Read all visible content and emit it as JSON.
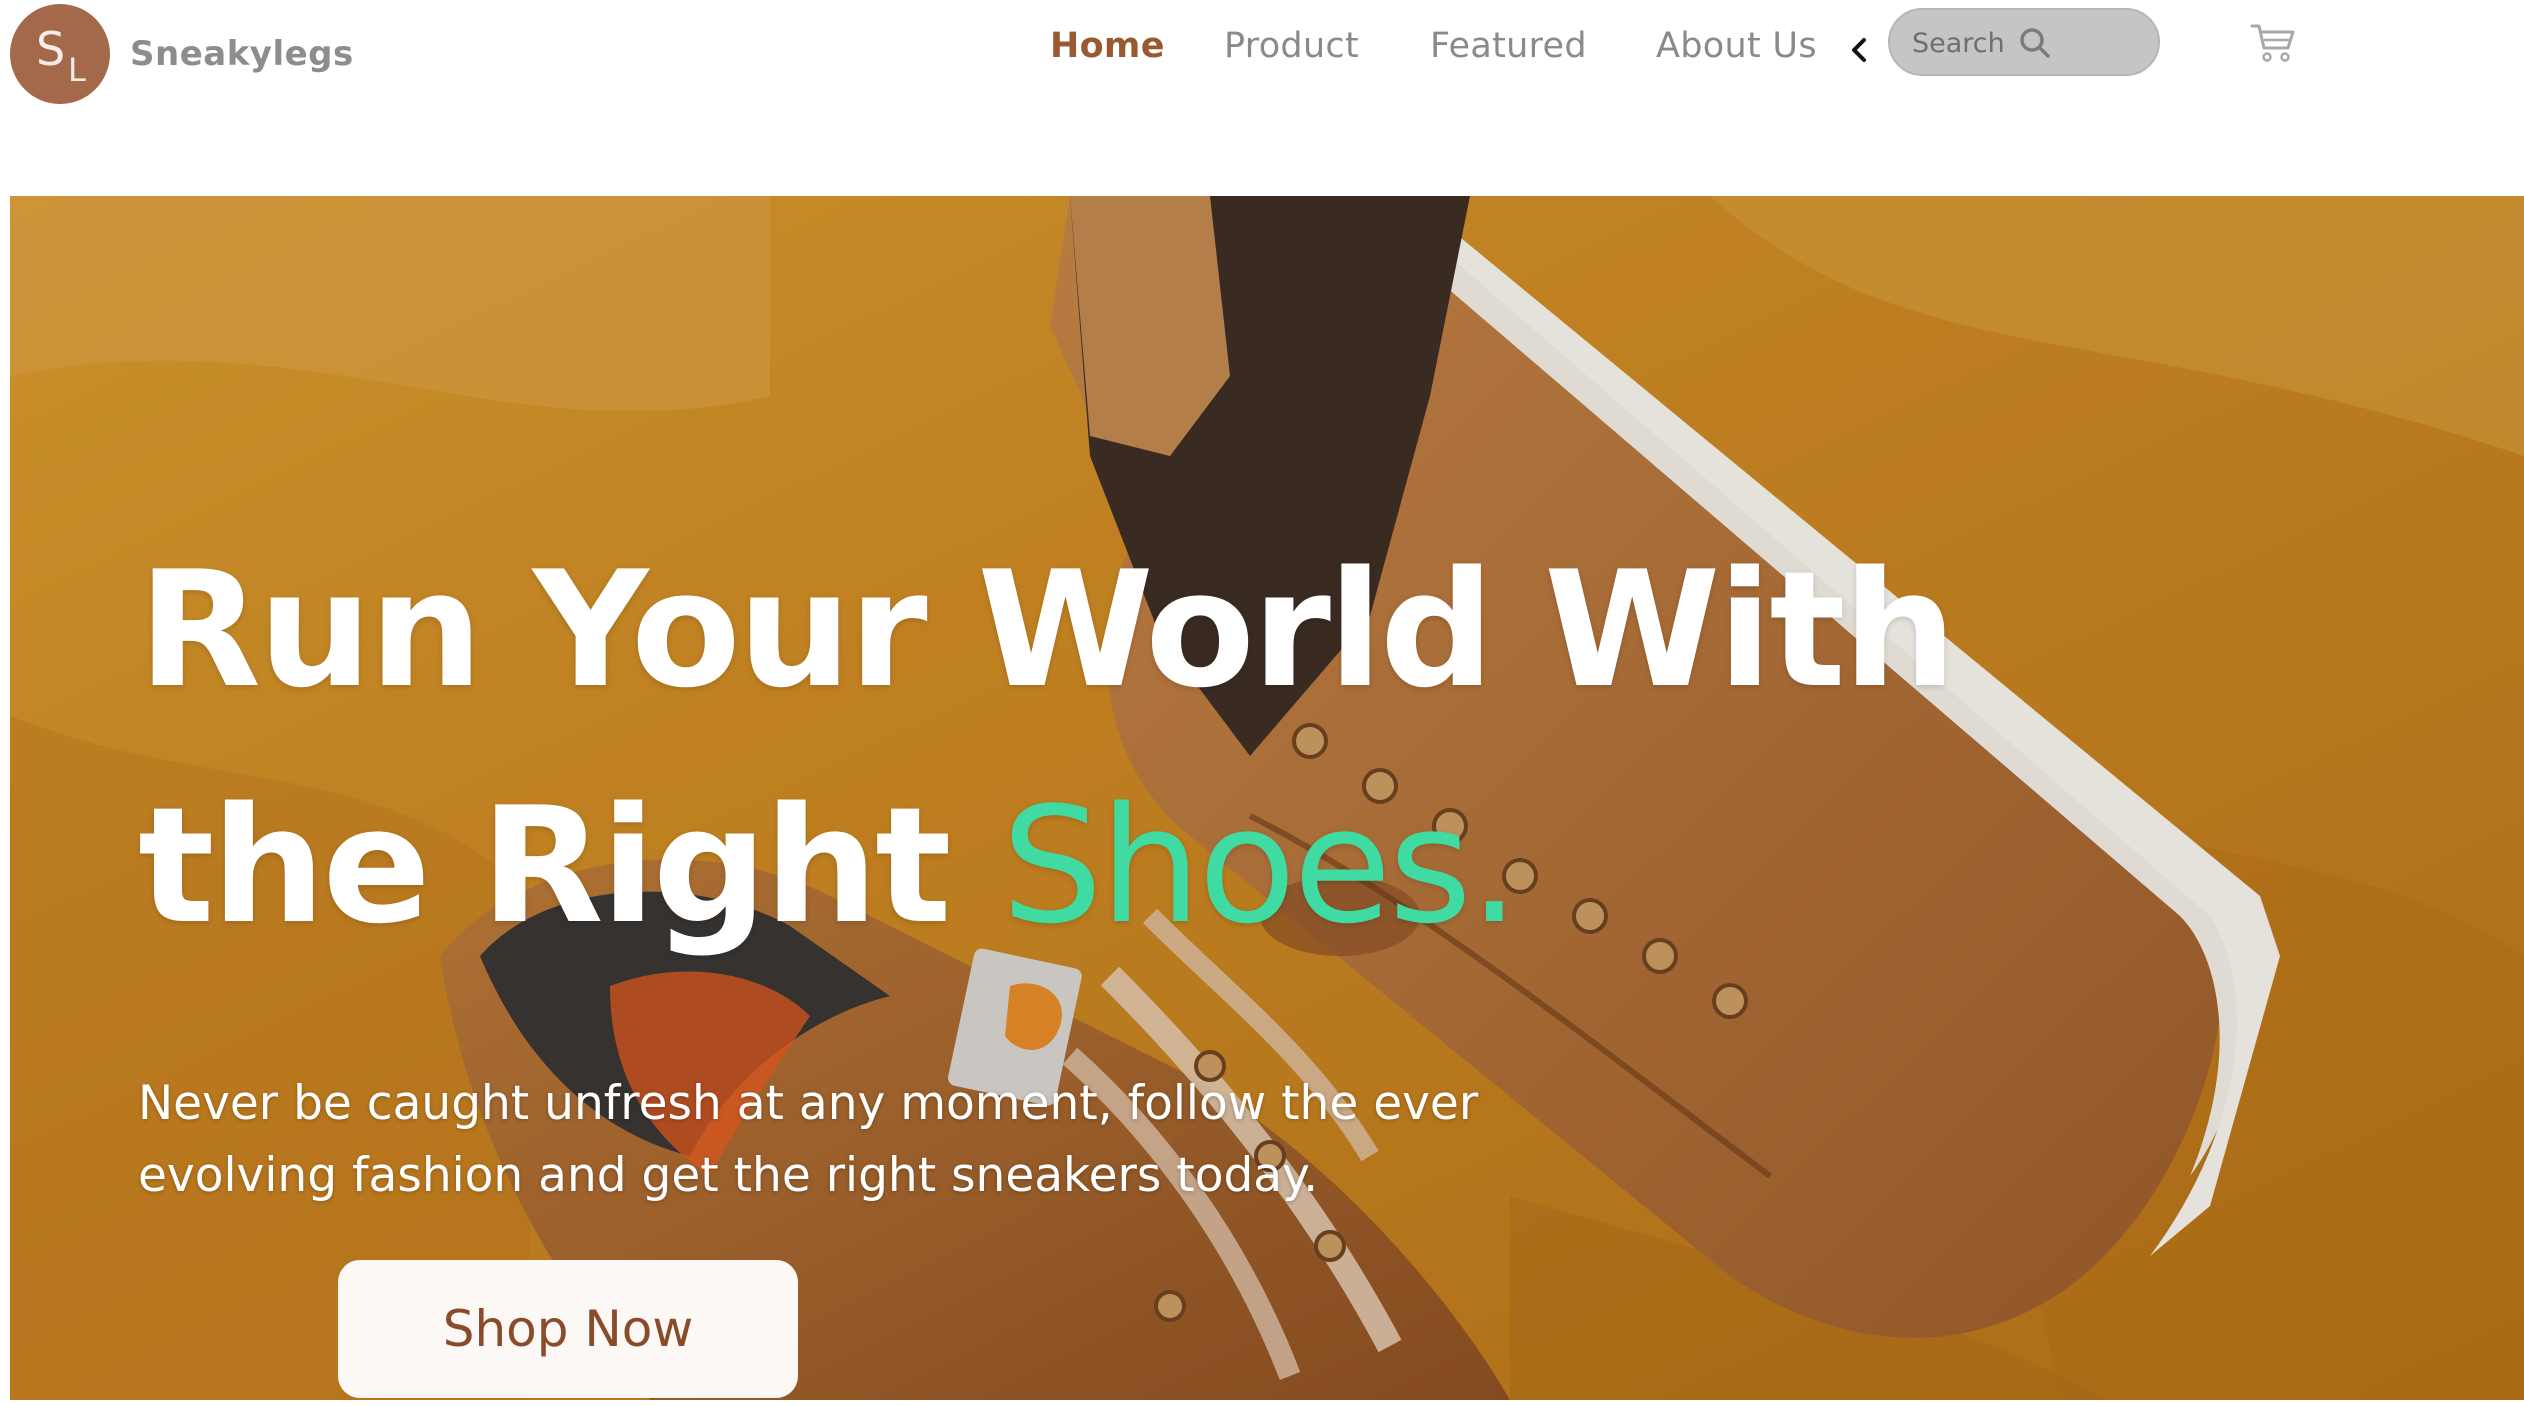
{
  "brand": {
    "initial_first": "S",
    "initial_second": "L",
    "name": "Sneakylegs"
  },
  "nav": {
    "items": [
      {
        "label": "Home",
        "active": true
      },
      {
        "label": "Product",
        "active": false
      },
      {
        "label": "Featured",
        "active": false
      },
      {
        "label": "About Us",
        "active": false
      }
    ],
    "collapse_icon": "chevron-left-icon"
  },
  "search": {
    "label": "Search",
    "icon": "search-icon"
  },
  "cart": {
    "icon": "cart-icon"
  },
  "hero": {
    "title_line1": "Run Your World With",
    "title_line2_start": "the Right",
    "title_accent": "Shoes.",
    "subtitle": "Never be caught unfresh at any moment, follow the ever evolving fashion and get the right sneakers today.",
    "cta_label": "Shop Now"
  },
  "colors": {
    "brand_brown": "#a4694a",
    "nav_active": "#9a5a31",
    "accent_green": "#3fdba2",
    "hero_background": "#c98822"
  }
}
